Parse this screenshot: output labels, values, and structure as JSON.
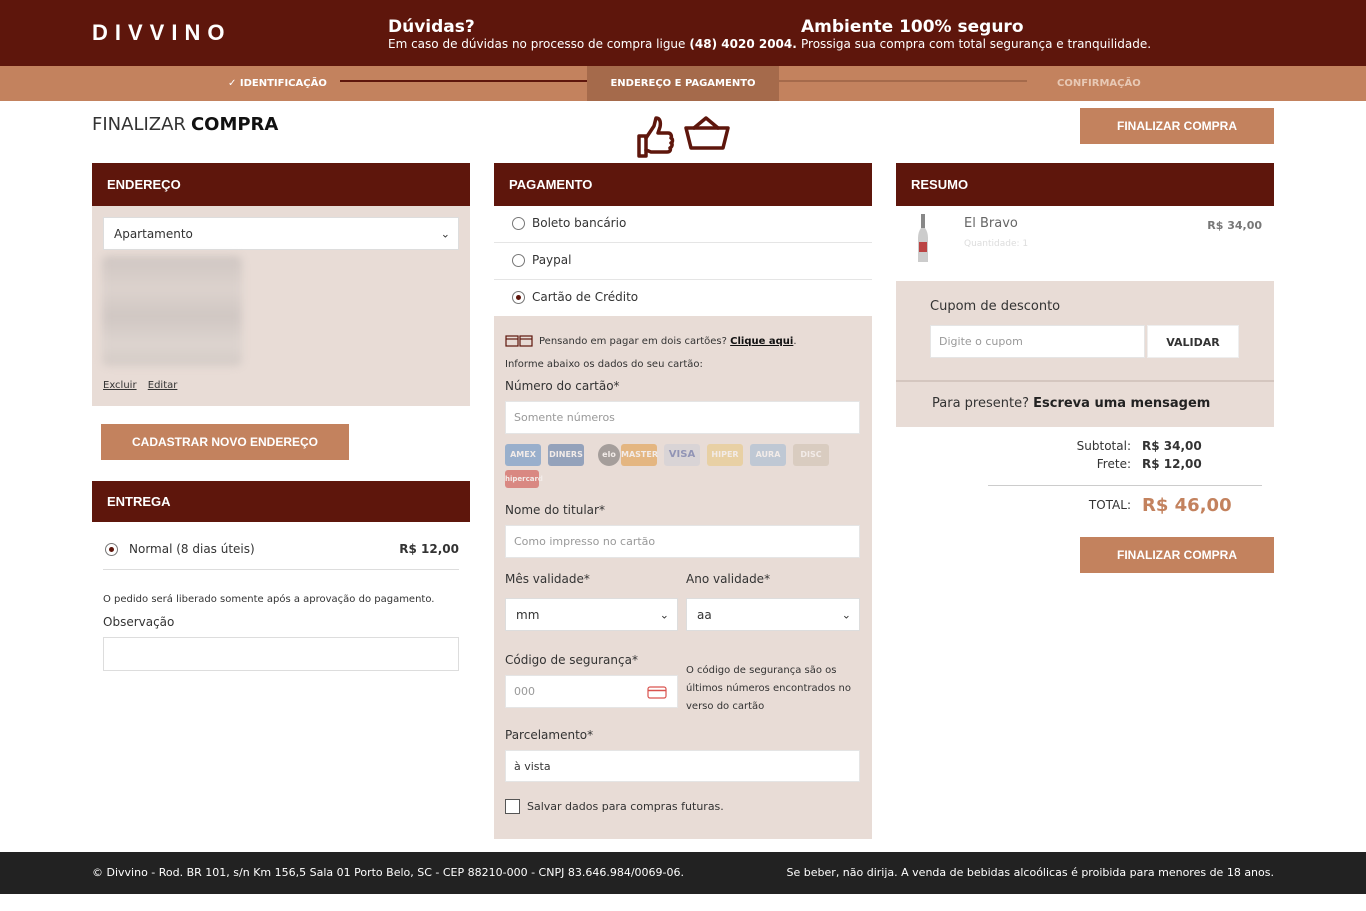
{
  "header": {
    "logo": "DIVVINO",
    "help_title": "Dúvidas?",
    "help_text": "Em caso de dúvidas no processo de compra ligue",
    "help_phone": "(48) 4020 2004.",
    "secure_title": "Ambiente 100% seguro",
    "secure_text": "Prossiga sua compra com total segurança e tranquilidade."
  },
  "steps": [
    "✓ IDENTIFICAÇÃO",
    "ENDEREÇO E PAGAMENTO",
    "CONFIRMAÇÃO"
  ],
  "page": {
    "title_light": "FINALIZAR",
    "title_bold": "COMPRA",
    "finalize_button": "FINALIZAR COMPRA"
  },
  "address": {
    "heading": "ENDEREÇO",
    "selected": "Apartamento",
    "delete_link": "Excluir",
    "edit_link": "Editar",
    "new_button": "CADASTRAR NOVO ENDEREÇO"
  },
  "delivery": {
    "heading": "ENTREGA",
    "option_label": "Normal (8 dias úteis)",
    "option_price": "R$ 12,00",
    "note": "O pedido será liberado somente após a aprovação do pagamento.",
    "observation_label": "Observação"
  },
  "payment": {
    "heading": "PAGAMENTO",
    "options": [
      "Boleto bancário",
      "Paypal",
      "Cartão de Crédito"
    ],
    "selected_index": 2,
    "two_cards_text": "Pensando em pagar em dois cartões?",
    "two_cards_link": "Clique aqui",
    "info_text": "Informe abaixo os dados do seu cartão:",
    "card_number_label": "Número do cartão*",
    "card_number_placeholder": "Somente números",
    "brands": [
      "AMEX",
      "DINERS",
      "elo",
      "MASTER",
      "VISA",
      "HIPER",
      "AURA",
      "DISC",
      "hipercard"
    ],
    "holder_label": "Nome do titular*",
    "holder_placeholder": "Como impresso no cartão",
    "month_label": "Mês validade*",
    "month_value": "mm",
    "year_label": "Ano validade*",
    "year_value": "aa",
    "cvv_label": "Código de segurança*",
    "cvv_placeholder": "000",
    "cvv_help": "O código de segurança são os últimos números encontrados no verso do cartão",
    "installments_label": "Parcelamento*",
    "installments_value": "à vista",
    "save_label": "Salvar dados para compras futuras."
  },
  "summary": {
    "heading": "RESUMO",
    "product_name": "El Bravo",
    "product_qty": "Quantidade: 1",
    "product_price": "R$ 34,00",
    "coupon_label": "Cupom de desconto",
    "coupon_placeholder": "Digite o cupom",
    "coupon_button": "VALIDAR",
    "gift_text": "Para presente?",
    "gift_link": "Escreva uma mensagem",
    "subtotal_label": "Subtotal:",
    "subtotal_value": "R$ 34,00",
    "shipping_label": "Frete:",
    "shipping_value": "R$ 12,00",
    "total_label": "TOTAL:",
    "total_value": "R$ 46,00"
  },
  "footer": {
    "left": "© Divvino - Rod. BR 101, s/n Km 156,5 Sala 01 Porto Belo, SC - CEP 88210-000 - CNPJ 83.646.984/0069-06.",
    "right": "Se beber, não dirija. A venda de bebidas alcoólicas é proibida para menores de 18 anos."
  },
  "colors": {
    "brand_dark": "#5e160c",
    "accent": "#c3825e",
    "panel_bg": "#e8dcd6"
  }
}
